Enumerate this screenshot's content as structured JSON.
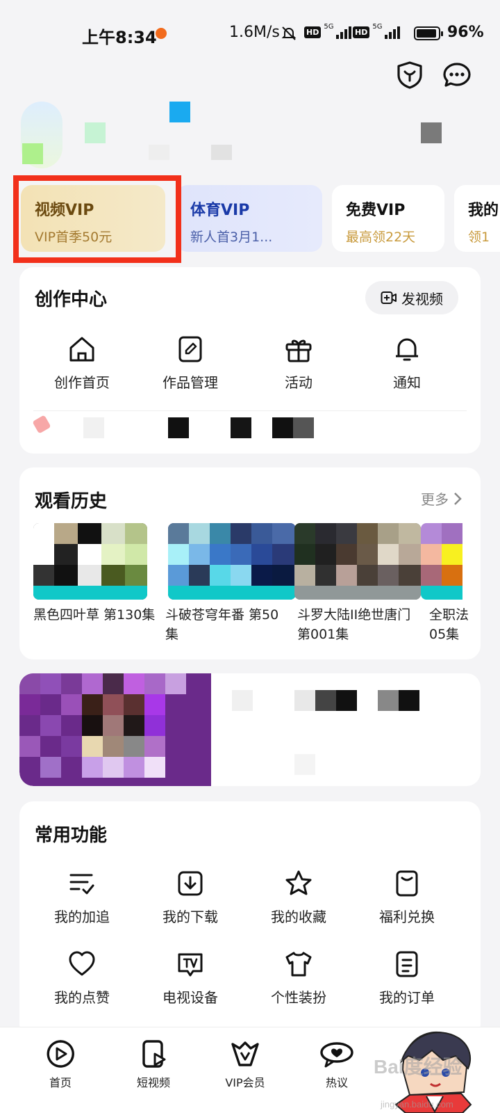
{
  "status_bar": {
    "time": "上午8:34",
    "net_speed": "1.6M/s",
    "hd1": "HD",
    "hd2": "HD",
    "net1": "5G",
    "net2": "5G",
    "battery": "96%"
  },
  "vip_cards": [
    {
      "title": "视频VIP",
      "subtitle": "VIP首季50元"
    },
    {
      "title": "体育VIP",
      "subtitle": "新人首3月1..."
    },
    {
      "title": "免费VIP",
      "subtitle": "最高领22天"
    },
    {
      "title": "我的",
      "subtitle": "领1"
    }
  ],
  "creation": {
    "title": "创作中心",
    "post_button": "发视频",
    "items": [
      {
        "label": "创作首页",
        "icon": "home-icon"
      },
      {
        "label": "作品管理",
        "icon": "edit-icon"
      },
      {
        "label": "活动",
        "icon": "gift-icon"
      },
      {
        "label": "通知",
        "icon": "bell-icon"
      }
    ]
  },
  "history": {
    "title": "观看历史",
    "more": "更多",
    "items": [
      {
        "title": "黑色四叶草 第130集"
      },
      {
        "title": "斗破苍穹年番 第50集"
      },
      {
        "title": "斗罗大陆II绝世唐门第001集"
      },
      {
        "title": "全职法05集"
      }
    ]
  },
  "functions": {
    "title": "常用功能",
    "items": [
      {
        "label": "我的加追",
        "icon": "follow-list-icon"
      },
      {
        "label": "我的下载",
        "icon": "download-icon"
      },
      {
        "label": "我的收藏",
        "icon": "star-icon"
      },
      {
        "label": "福利兑换",
        "icon": "coupon-icon"
      },
      {
        "label": "我的点赞",
        "icon": "heart-icon"
      },
      {
        "label": "电视设备",
        "icon": "tv-icon"
      },
      {
        "label": "个性装扮",
        "icon": "shirt-icon"
      },
      {
        "label": "我的订单",
        "icon": "order-icon"
      }
    ]
  },
  "bottom_nav": [
    {
      "label": "首页",
      "icon": "play-icon"
    },
    {
      "label": "短视频",
      "icon": "short-video-icon"
    },
    {
      "label": "VIP会员",
      "icon": "vip-crown-icon"
    },
    {
      "label": "热议",
      "icon": "discuss-icon"
    }
  ],
  "watermark": {
    "text": "Bai度经验",
    "sub": "jingyan.baidu.com"
  },
  "colors": {
    "highlight": "#f2301b",
    "vip_gold": "#7a5a1c",
    "sports_blue": "#1a3aa8",
    "free_gold": "#c89a3c"
  }
}
